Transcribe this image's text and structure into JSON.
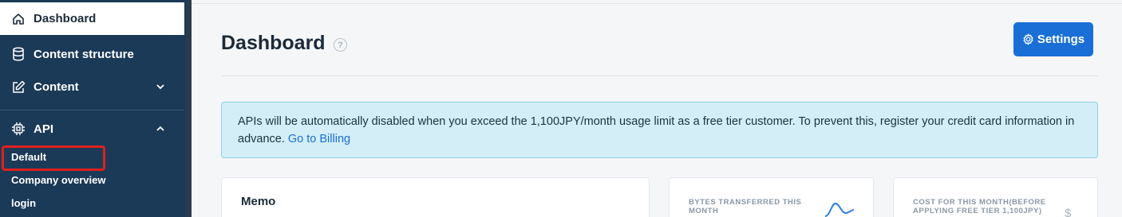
{
  "sidebar": {
    "items": [
      {
        "label": "Dashboard",
        "icon": "home-icon",
        "active": true
      },
      {
        "label": "Content structure",
        "icon": "database-icon"
      },
      {
        "label": "Content",
        "icon": "edit-icon"
      },
      {
        "label": "API",
        "icon": "chip-icon"
      }
    ],
    "api_sub_items": [
      "Default",
      "Company overview",
      "login"
    ]
  },
  "header": {
    "title": "Dashboard",
    "help_glyph": "?",
    "settings_label": "Settings"
  },
  "alert": {
    "text": "APIs will be automatically disabled when you exceed the 1,100JPY/month usage limit as a free tier customer. To prevent this, register your credit card information in advance. ",
    "link_label": "Go to Billing"
  },
  "cards": {
    "memo_title": "Memo",
    "bytes_label": "BYTES TRANSFERRED THIS MONTH",
    "cost_label": "COST FOR THIS MONTH(BEFORE APPLYING FREE TIER 1,100JPY)",
    "currency_glyph": "$"
  },
  "colors": {
    "sidebar_bg": "#1b3a57",
    "accent": "#1a6fd6",
    "alert_bg": "#d3eef7",
    "highlight": "#e0201e"
  }
}
